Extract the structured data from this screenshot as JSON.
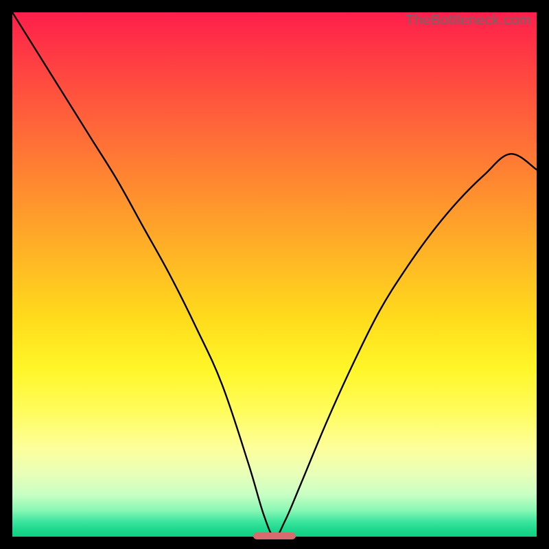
{
  "watermark": "TheBottleneck.com",
  "colors": {
    "frame": "#000000",
    "curve_stroke": "#000000",
    "pill": "#d86b6e",
    "watermark_text": "#6a6a6a"
  },
  "chart_data": {
    "type": "line",
    "title": "",
    "xlabel": "",
    "ylabel": "",
    "xlim": [
      0,
      100
    ],
    "ylim": [
      0,
      100
    ],
    "grid": false,
    "note": "V-shaped bottleneck curve over a vertical heat gradient. No axis ticks or labels rendered. Curve minimum is near x≈50 at y≈0. Values below are estimated from pixel geometry.",
    "series": [
      {
        "name": "bottleneck-curve",
        "x": [
          0,
          5,
          10,
          15,
          20,
          25,
          30,
          35,
          40,
          45,
          48,
          50,
          52,
          55,
          60,
          65,
          70,
          75,
          80,
          85,
          90,
          95,
          100
        ],
        "y": [
          100,
          92,
          84,
          76,
          68,
          59,
          50,
          40,
          29,
          14,
          4,
          0,
          3,
          10,
          22,
          33,
          43,
          51,
          58,
          64,
          69,
          73,
          70
        ]
      }
    ],
    "marker": {
      "name": "optimal-range-pill",
      "x_start": 46,
      "x_end": 54,
      "y": 0
    },
    "background_gradient_stops": [
      {
        "pos": 0.0,
        "color": "#ff1e4b"
      },
      {
        "pos": 0.5,
        "color": "#ffda1c"
      },
      {
        "pos": 0.83,
        "color": "#fdff9a"
      },
      {
        "pos": 1.0,
        "color": "#0fcf82"
      }
    ]
  }
}
